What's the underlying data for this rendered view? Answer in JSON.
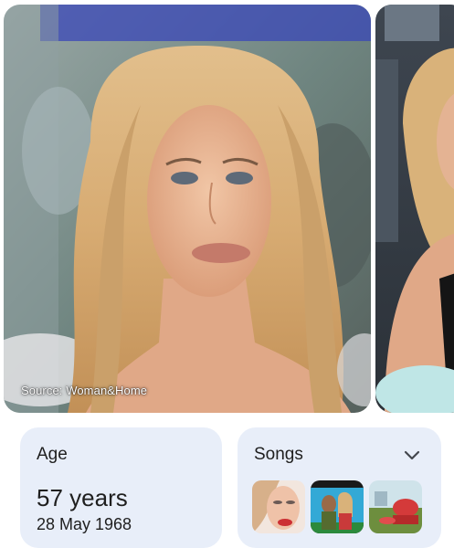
{
  "carousel": {
    "source_label": "Source: Woman&Home",
    "images": [
      "kylie-minogue-portrait",
      "kylie-minogue-event"
    ]
  },
  "age_card": {
    "title": "Age",
    "value": "57 years",
    "birth_date": "28 May 1968"
  },
  "songs_card": {
    "title": "Songs",
    "expand_icon": "chevron-down-icon",
    "thumbnails": [
      "song-thumbnail-1",
      "song-thumbnail-2",
      "song-thumbnail-3"
    ]
  },
  "colors": {
    "card_background": "#e8eef9",
    "text": "#1f1f1f",
    "chevron": "#44474e"
  }
}
